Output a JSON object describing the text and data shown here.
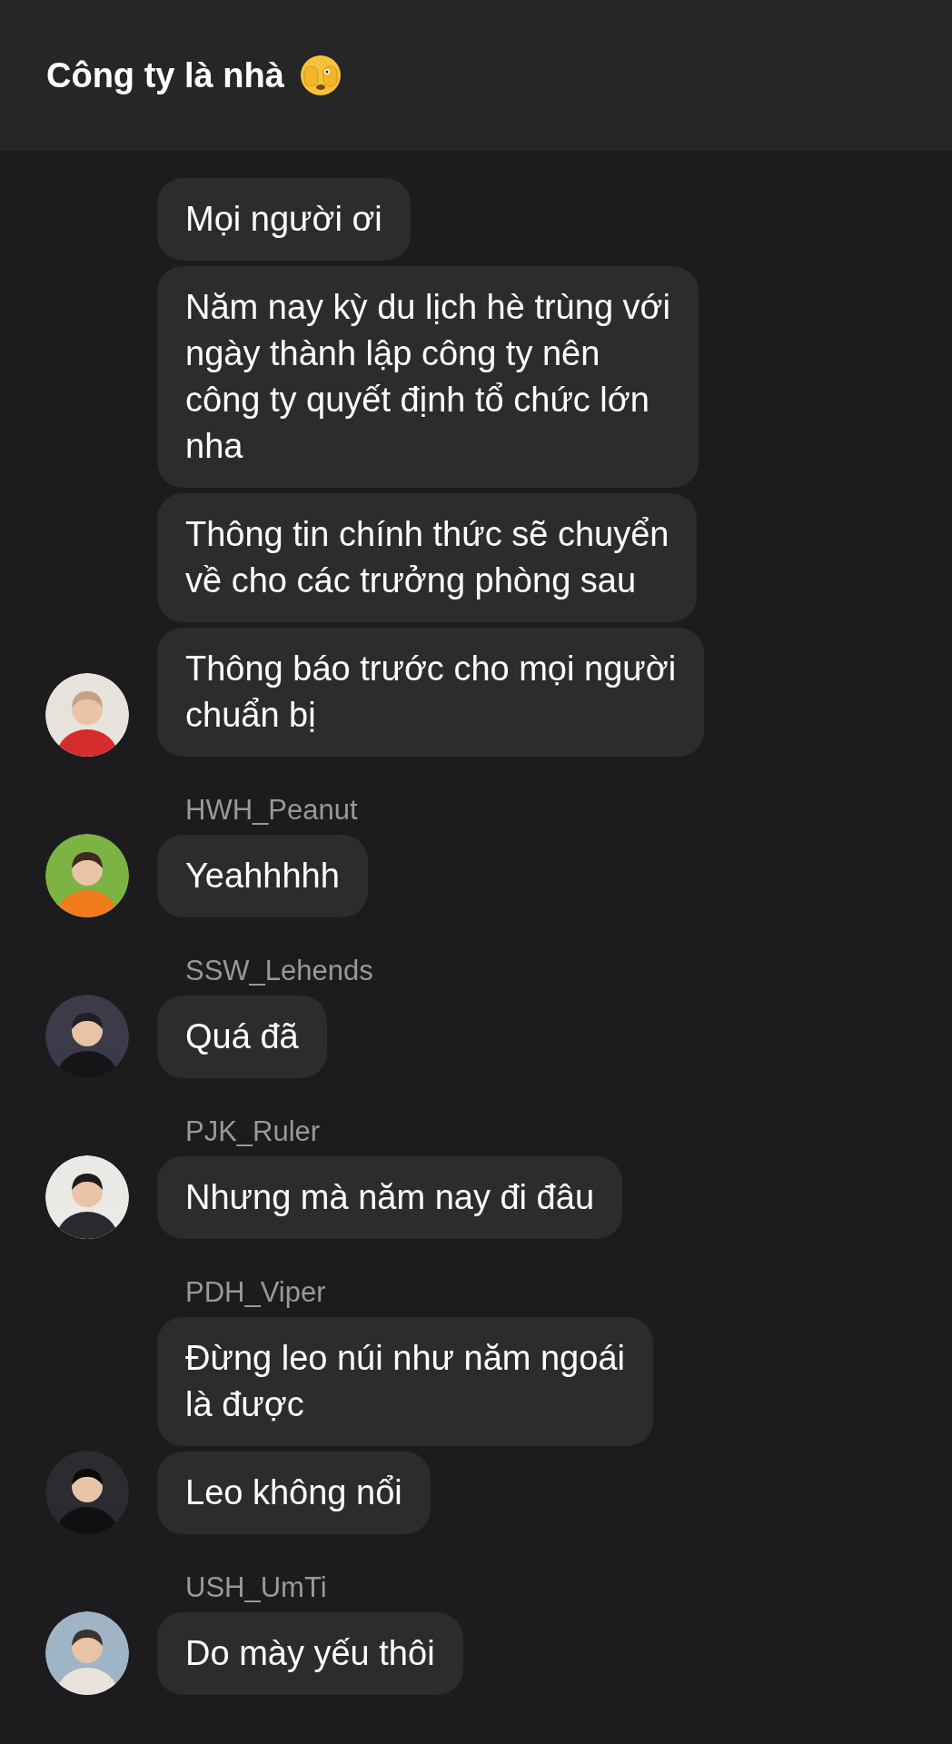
{
  "header": {
    "title": "Công ty là nhà"
  },
  "groups": [
    {
      "avatar": {
        "kind": "picture"
      },
      "messages": [
        {
          "lines": [
            "Mọi người ơi"
          ]
        },
        {
          "lines": [
            "Năm nay kỳ du lịch hè trùng với",
            "ngày thành lập công ty nên",
            "công ty quyết định tổ chức lớn",
            "nha"
          ]
        },
        {
          "lines": [
            "Thông tin chính thức sẽ chuyển",
            "về cho các trưởng phòng sau"
          ]
        },
        {
          "lines": [
            "Thông báo trước cho mọi người",
            "chuẩn bị"
          ]
        }
      ]
    },
    {
      "sender": "HWH_Peanut",
      "avatar": {
        "kind": "picture"
      },
      "messages": [
        {
          "lines": [
            "Yeahhhhh"
          ]
        }
      ]
    },
    {
      "sender": "SSW_Lehends",
      "avatar": {
        "kind": "picture"
      },
      "messages": [
        {
          "lines": [
            "Quá đã"
          ]
        }
      ]
    },
    {
      "sender": "PJK_Ruler",
      "avatar": {
        "kind": "picture"
      },
      "messages": [
        {
          "lines": [
            "Nhưng mà năm nay đi đâu"
          ]
        }
      ]
    },
    {
      "sender": "PDH_Viper",
      "avatar": {
        "kind": "picture"
      },
      "messages": [
        {
          "lines": [
            "Đừng leo núi như năm ngoái",
            "là được"
          ]
        },
        {
          "lines": [
            "Leo không nổi"
          ]
        }
      ]
    },
    {
      "sender": "USH_UmTi",
      "avatar": {
        "kind": "picture"
      },
      "messages": [
        {
          "lines": [
            "Do mày yếu thôi"
          ]
        }
      ]
    }
  ]
}
